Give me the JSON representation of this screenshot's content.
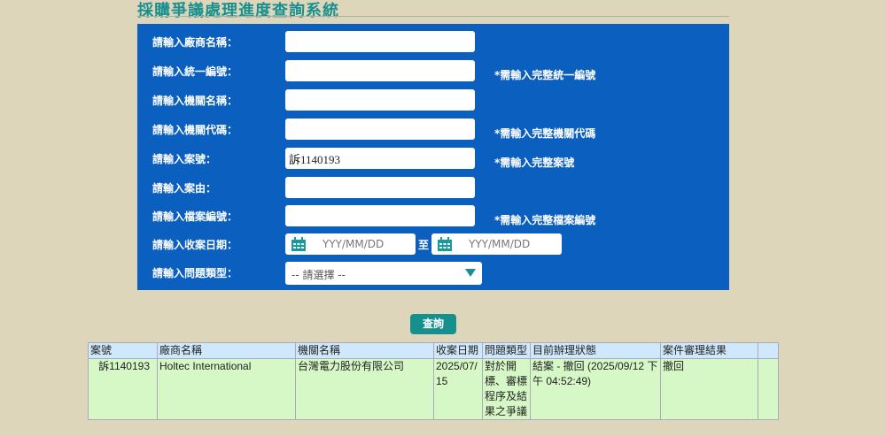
{
  "title": "採購爭議處理進度查詢系統",
  "form": {
    "vendor_label": "請輸入廠商名稱：",
    "vendor_value": "",
    "tax_label": "請輸入統一編號：",
    "tax_value": "",
    "tax_note": "*需輸入完整統一編號",
    "agency_label": "請輸入機關名稱：",
    "agency_value": "",
    "agency_code_label": "請輸入機關代碼：",
    "agency_code_value": "",
    "agency_code_note": "*需輸入完整機關代碼",
    "case_label": "請輸入案號：",
    "case_value": "訴1140193",
    "case_note": "*需輸入完整案號",
    "reason_label": "請輸入案由：",
    "reason_value": "",
    "file_label": "請輸入檔案編號：",
    "file_value": "",
    "file_note": "*需輸入完整檔案編號",
    "date_label": "請輸入收案日期：",
    "date_placeholder": "YYY/MM/DD",
    "date_to": "至",
    "type_label": "請輸入問題類型：",
    "type_selected": "-- 請選擇 --"
  },
  "search_button": "查詢",
  "table": {
    "headers": [
      "案號",
      "廠商名稱",
      "機關名稱",
      "收案日期",
      "問題類型",
      "目前辦理狀態",
      "案件審理結果",
      ""
    ],
    "rows": [
      [
        "訴1140193",
        "Holtec International",
        "台灣電力股份有限公司",
        "2025/07/15",
        "對於開標、審標程序及結果之爭議",
        "結案 - 撤回 (2025/09/12 下午 04:52:49)",
        "撤回",
        ""
      ]
    ]
  },
  "colors": {
    "form_bg": "#0a5fbf",
    "accent": "#15908f",
    "header_bg": "#cfe8fb",
    "row_bg": "#d5f8c6"
  }
}
